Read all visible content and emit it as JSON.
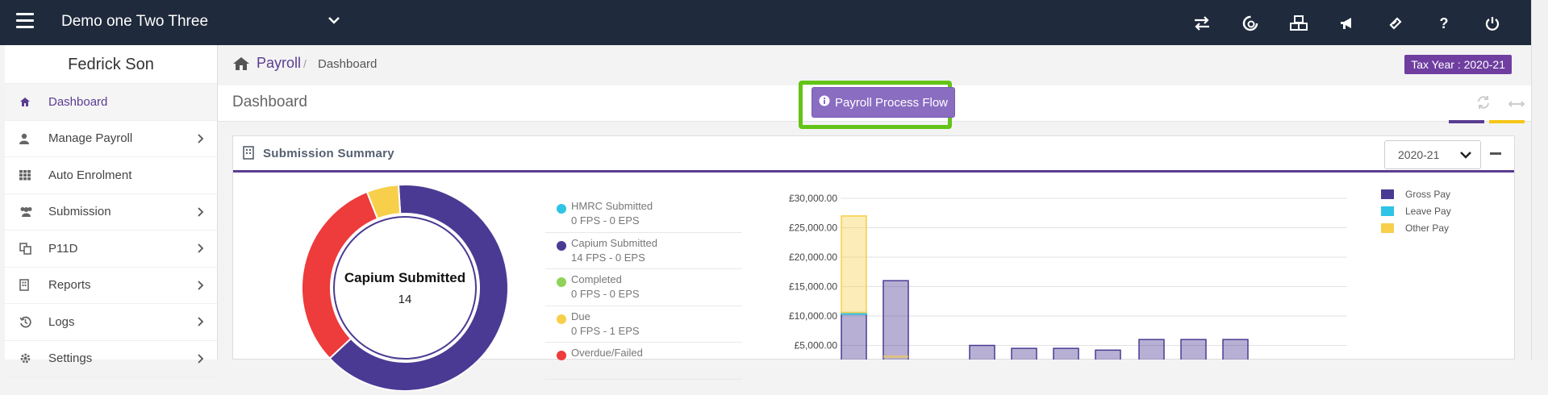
{
  "topbar": {
    "company": "Demo one Two Three",
    "icons": [
      "exchange-icon",
      "capium-icon",
      "cubes-icon",
      "megaphone-icon",
      "ticket-icon",
      "question-icon",
      "power-icon"
    ]
  },
  "sidebar": {
    "user_name": "Fedrick Son",
    "items": [
      {
        "label": "Dashboard",
        "icon": "home-icon",
        "has_children": false
      },
      {
        "label": "Manage Payroll",
        "icon": "user-icon",
        "has_children": true
      },
      {
        "label": "Auto Enrolment",
        "icon": "grid-icon",
        "has_children": false
      },
      {
        "label": "Submission",
        "icon": "users-icon",
        "has_children": true
      },
      {
        "label": "P11D",
        "icon": "copy-icon",
        "has_children": true
      },
      {
        "label": "Reports",
        "icon": "building-icon",
        "has_children": true
      },
      {
        "label": "Logs",
        "icon": "history-icon",
        "has_children": true
      },
      {
        "label": "Settings",
        "icon": "gear-icon",
        "has_children": true
      }
    ]
  },
  "breadcrumb": {
    "section": "Payroll",
    "separator": "/",
    "current": "Dashboard"
  },
  "tax_year_badge": "Tax Year : 2020-21",
  "dashboard": {
    "title": "Dashboard",
    "flow_button": "Payroll Process Flow"
  },
  "panel": {
    "title": "Submission Summary",
    "year_selected": "2020-21"
  },
  "donut": {
    "center_title": "Capium Submitted",
    "center_value": "14",
    "segments": [
      {
        "label": "Capium Submitted",
        "fraction": 0.64,
        "color": "#4b3a93"
      },
      {
        "label": "Overdue/Failed",
        "fraction": 0.31,
        "color": "#ee3b3b"
      },
      {
        "label": "Due",
        "fraction": 0.05,
        "color": "#f7cf4a"
      }
    ]
  },
  "statuses": [
    {
      "name": "HMRC Submitted",
      "counts": "0 FPS - 0 EPS",
      "color": "#2ec4e6"
    },
    {
      "name": "Capium Submitted",
      "counts": "14 FPS - 0 EPS",
      "color": "#4b3a93"
    },
    {
      "name": "Completed",
      "counts": "0 FPS - 0 EPS",
      "color": "#8fd35a"
    },
    {
      "name": "Due",
      "counts": "0 FPS - 1 EPS",
      "color": "#f7cf4a"
    },
    {
      "name": "Overdue/Failed",
      "counts": "",
      "color": "#ee3b3b"
    }
  ],
  "chart_data": {
    "type": "bar",
    "stacked": true,
    "ylim": [
      0,
      30000
    ],
    "ytick_labels": [
      "£30,000.00",
      "£25,000.00",
      "£20,000.00",
      "£15,000.00",
      "£10,000.00",
      "£5,000.00"
    ],
    "ytick_values": [
      30000,
      25000,
      20000,
      15000,
      10000,
      5000
    ],
    "categories": [
      "",
      "",
      "",
      "",
      "",
      "",
      "",
      "",
      "",
      ""
    ],
    "series": [
      {
        "name": "Gross Pay",
        "color": "#4b3a93",
        "values": [
          10300,
          16000,
          0,
          5000,
          4500,
          4500,
          4200,
          6000,
          6000,
          6000
        ]
      },
      {
        "name": "Leave Pay",
        "color": "#2ec4e6",
        "values": [
          300,
          0,
          0,
          0,
          0,
          0,
          0,
          0,
          0,
          0
        ]
      },
      {
        "name": "Other Pay",
        "color": "#f7cf4a",
        "values": [
          16400,
          0,
          0,
          0,
          0,
          0,
          0,
          0,
          0,
          0
        ]
      }
    ],
    "grid": true,
    "legend": "top-right"
  }
}
